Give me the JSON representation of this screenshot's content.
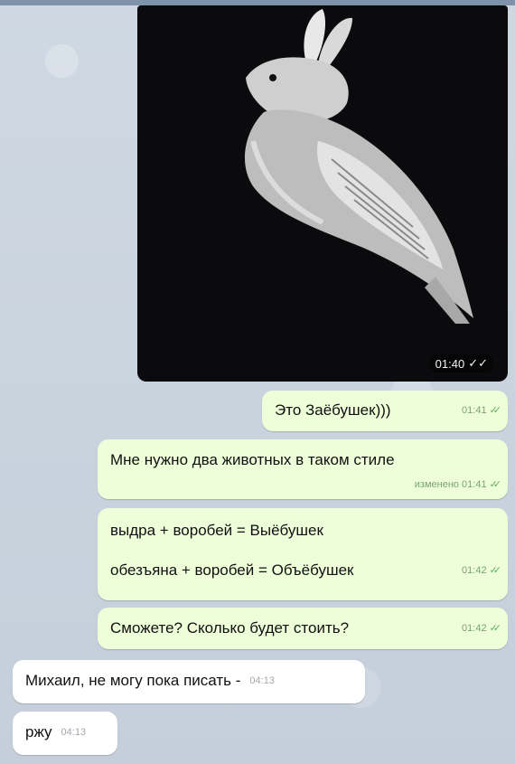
{
  "photo": {
    "time": "01:40"
  },
  "messages": [
    {
      "text": "Это Заёбушек)))",
      "time": "01:41"
    },
    {
      "text": "Мне нужно два животных в таком стиле",
      "edited": "изменено",
      "time": "01:41"
    },
    {
      "line1": "выдра + воробей = Выёбушек",
      "line2": "обезъяна + воробей = Объёбушек",
      "time": "01:42"
    },
    {
      "text": "Сможете? Сколько будет стоить?",
      "time": "01:42"
    },
    {
      "text": "Михаил, не могу пока писать -",
      "time": "04:13"
    },
    {
      "text": "ржу",
      "time": "04:13"
    }
  ],
  "icons": {
    "read": "double-check-icon"
  },
  "colors": {
    "outgoing": "#eefed9",
    "incoming": "#ffffff",
    "wallpaper": "#c9d3df"
  }
}
